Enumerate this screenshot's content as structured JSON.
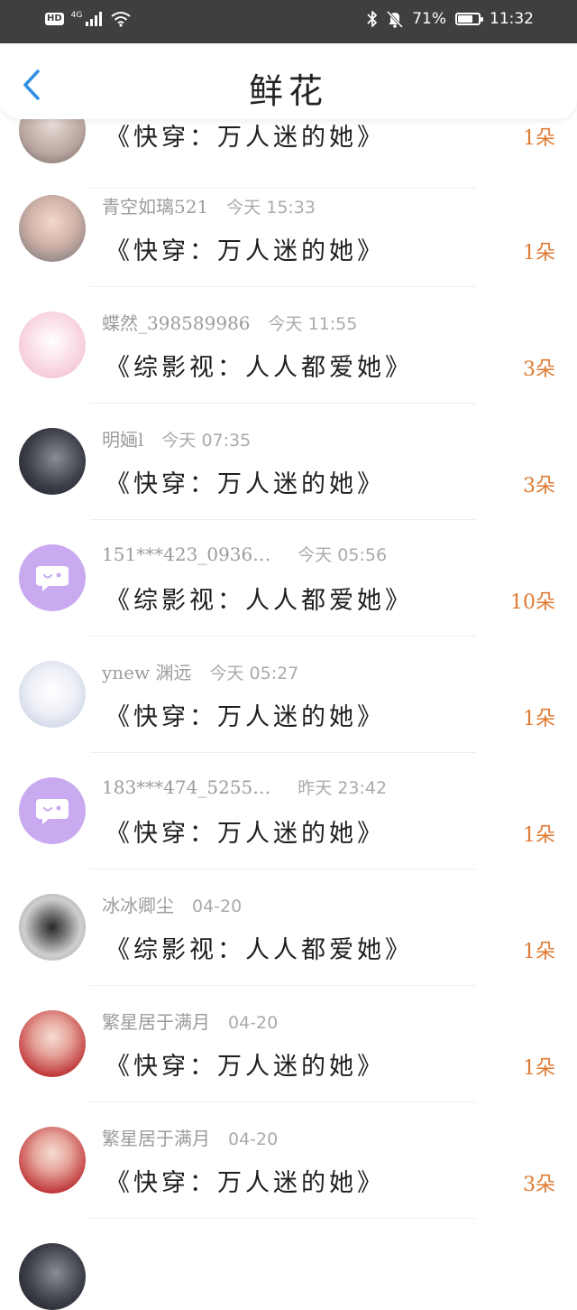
{
  "status_bar": {
    "hd": "HD",
    "network": "4G",
    "battery_text": "71%",
    "battery_level": 0.71,
    "time": "11:32"
  },
  "header": {
    "title": "鲜花"
  },
  "items": [
    {
      "name": "",
      "time": "",
      "book": "《快穿：万人迷的她》",
      "count": "1朵",
      "avatar": "partial"
    },
    {
      "name": "青空如璃521",
      "time": "今天 15:33",
      "book": "《快穿：万人迷的她》",
      "count": "1朵",
      "avatar": "photo"
    },
    {
      "name": "蝶然_398589986",
      "time": "今天 11:55",
      "book": "《综影视：人人都爱她》",
      "count": "3朵",
      "avatar": "pink"
    },
    {
      "name": "明婳l",
      "time": "今天 07:35",
      "book": "《快穿：万人迷的她》",
      "count": "3朵",
      "avatar": "dark"
    },
    {
      "name": "151***423_0936…",
      "time": "今天 05:56",
      "book": "《综影视：人人都爱她》",
      "count": "10朵",
      "avatar": "purple"
    },
    {
      "name": "ynew 渊远",
      "time": "今天 05:27",
      "book": "《快穿：万人迷的她》",
      "count": "1朵",
      "avatar": "girl"
    },
    {
      "name": "183***474_5255…",
      "time": "昨天 23:42",
      "book": "《快穿：万人迷的她》",
      "count": "1朵",
      "avatar": "purple"
    },
    {
      "name": "冰冰卿尘",
      "time": "04-20",
      "book": "《综影视：人人都爱她》",
      "count": "1朵",
      "avatar": "eye"
    },
    {
      "name": "繁星居于满月",
      "time": "04-20",
      "book": "《快穿：万人迷的她》",
      "count": "1朵",
      "avatar": "red"
    },
    {
      "name": "繁星居于满月",
      "time": "04-20",
      "book": "《快穿：万人迷的她》",
      "count": "3朵",
      "avatar": "red"
    }
  ],
  "colors": {
    "accent_back": "#2f8fe6",
    "count_orange": "#e07a32",
    "status_bar_bg": "#3f3f3f",
    "purple_avatar": "#c9a9ef"
  }
}
